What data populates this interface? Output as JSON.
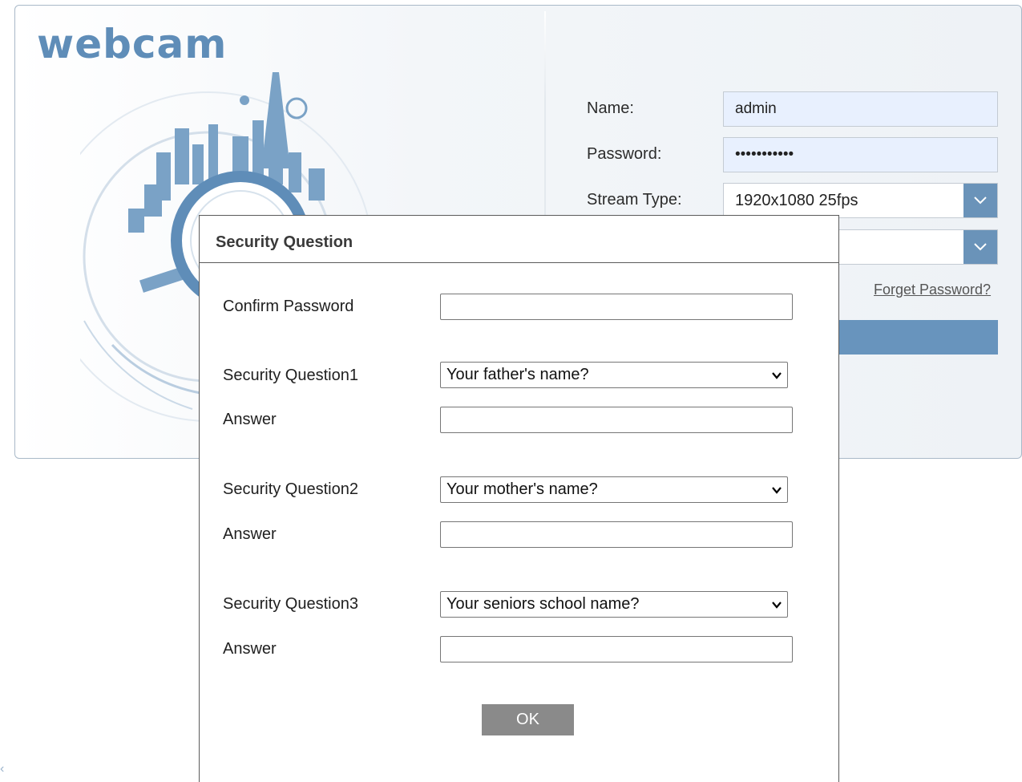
{
  "login": {
    "logo_text": "webcam",
    "name_label": "Name:",
    "name_value": "admin",
    "password_label": "Password:",
    "password_value": "•••••••••••",
    "stream_type_label": "Stream Type:",
    "stream_type_value": "1920x1080 25fps",
    "forget_password_link": "Forget Password?",
    "accent_color": "#6894bd"
  },
  "dialog": {
    "title": "Security Question",
    "confirm_password_label": "Confirm Password",
    "question1_label": "Security Question1",
    "question1_value": "Your father's name?",
    "answer1_label": "Answer",
    "question2_label": "Security Question2",
    "question2_value": "Your mother's name?",
    "answer2_label": "Answer",
    "question3_label": "Security Question3",
    "question3_value": "Your seniors school name?",
    "answer3_label": "Answer",
    "ok_label": "OK"
  },
  "icons": [
    "dropdown-chevron-icon",
    "select-chevron-icon",
    "camera-aperture-icon"
  ]
}
